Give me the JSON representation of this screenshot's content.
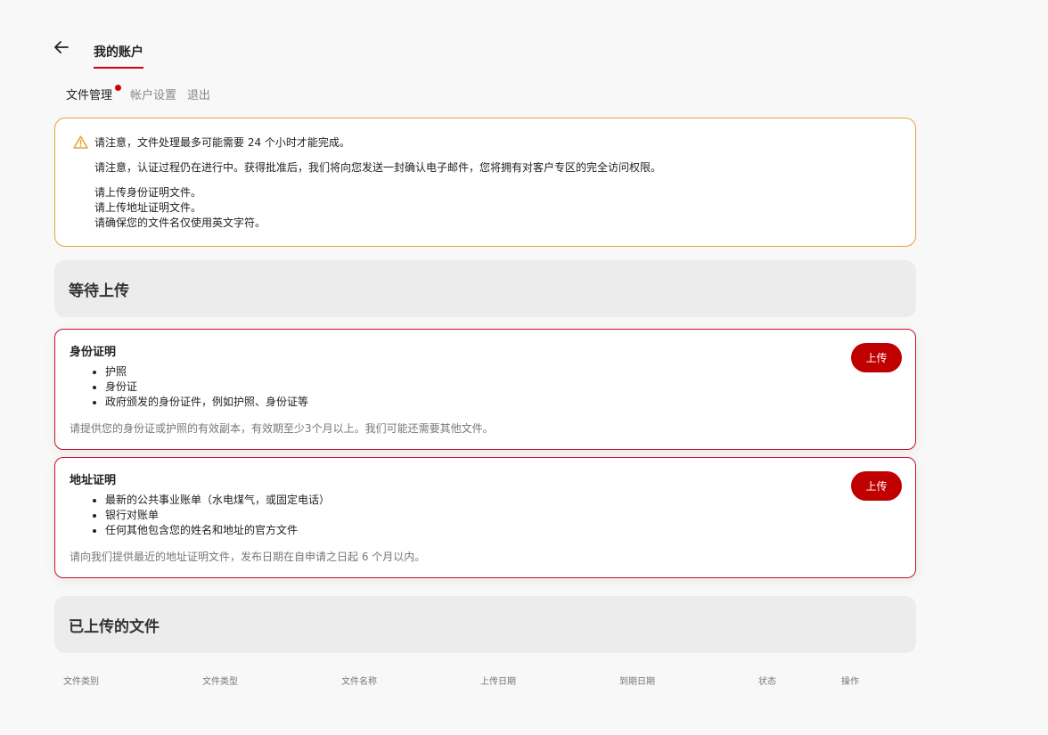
{
  "header": {
    "title": "我的账户"
  },
  "subnav": {
    "files": "文件管理",
    "settings": "帐户设置",
    "logout": "退出"
  },
  "notice": {
    "line1": "请注意，文件处理最多可能需要 24 个小时才能完成。",
    "line2": "请注意，认证过程仍在进行中。获得批准后，我们将向您发送一封确认电子邮件，您将拥有对客户专区的完全访问权限。",
    "line3": "请上传身份证明文件。",
    "line4": "请上传地址证明文件。",
    "line5": "请确保您的文件名仅使用英文字符。"
  },
  "pending": {
    "heading": "等待上传"
  },
  "identity": {
    "title": "身份证明",
    "items": [
      "护照",
      "身份证",
      "政府颁发的身份证件，例如护照、身份证等"
    ],
    "desc": "请提供您的身份证或护照的有效副本，有效期至少3个月以上。我们可能还需要其他文件。",
    "button": "上传"
  },
  "address": {
    "title": "地址证明",
    "items": [
      "最新的公共事业账单（水电煤气，或固定电话）",
      "银行对账单",
      "任何其他包含您的姓名和地址的官方文件"
    ],
    "desc": "请向我们提供最近的地址证明文件，发布日期在自申请之日起 6 个月以内。",
    "button": "上传"
  },
  "uploaded": {
    "heading": "已上传的文件"
  },
  "table": {
    "columns": [
      "文件类别",
      "文件类型",
      "文件名称",
      "上传日期",
      "到期日期",
      "状态",
      "操作"
    ]
  },
  "colors": {
    "accent": "#d0000f",
    "button": "#c00000",
    "warning": "#e6a236"
  },
  "icons": {
    "back": "arrow-left-icon",
    "warning": "warning-triangle-icon"
  }
}
